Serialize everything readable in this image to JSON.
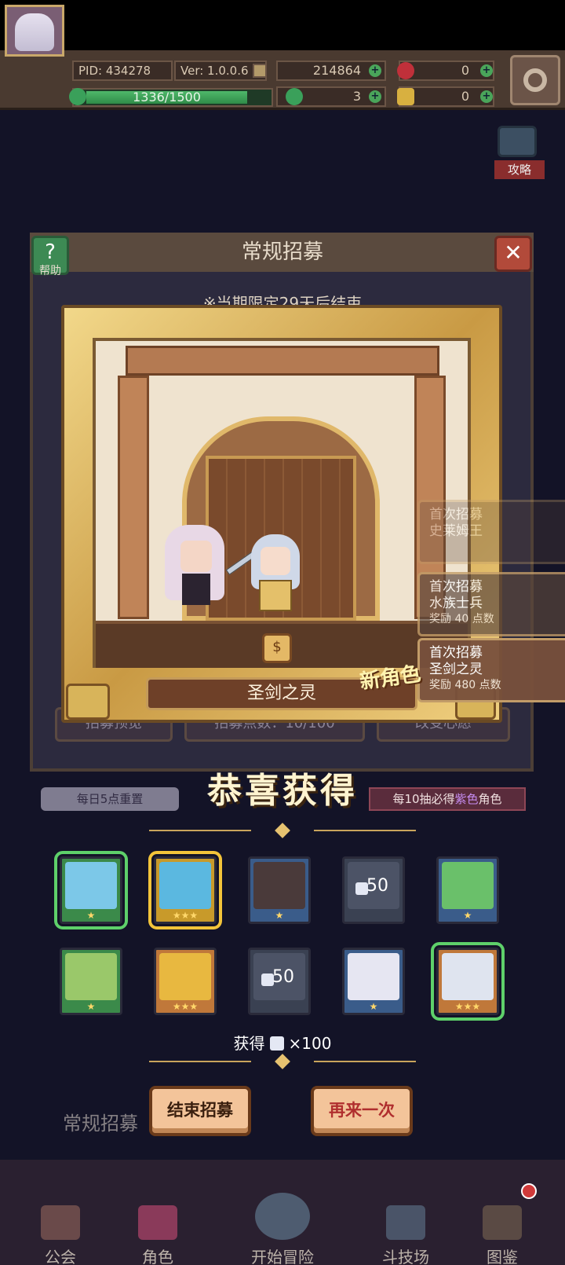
{
  "top_bar": {
    "pid": "PID: 434278",
    "version": "Ver: 1.0.0.6",
    "exp": "1336/1500",
    "gold": "214864",
    "gem": "0",
    "clover": "3",
    "key": "0"
  },
  "guide": {
    "label": "攻略"
  },
  "panel": {
    "title": "常规招募",
    "help_label": "帮助",
    "limit_text": "※当期限定29天后结束",
    "buttons": [
      "招募预览",
      "招募点数：10/100",
      "改变心愿"
    ]
  },
  "reveal": {
    "character_name": "圣剑之灵",
    "new_character_tag": "新角色"
  },
  "notifications": [
    {
      "title": "首次招募",
      "name": "史莱姆王",
      "reward": ""
    },
    {
      "title": "首次招募",
      "name": "水族士兵",
      "reward": "奖励 40 点数"
    },
    {
      "title": "首次招募",
      "name": "圣剑之灵",
      "reward": "奖励 480 点数"
    }
  ],
  "congrats": "恭喜获得",
  "daily_reset": "每日5点重置",
  "guarantee": {
    "prefix": "每10抽必得",
    "highlight": "紫色",
    "suffix": "角色"
  },
  "rewards": [
    {
      "type": "character",
      "stars": "★",
      "portrait_color": "#7cc8e8",
      "frame": "green",
      "selected": "green"
    },
    {
      "type": "character",
      "stars": "★★★",
      "portrait_color": "#5bb8e0",
      "frame": "gold",
      "selected": "gold"
    },
    {
      "type": "character",
      "stars": "★",
      "portrait_color": "#4a3a3a",
      "frame": "blue",
      "selected": ""
    },
    {
      "type": "item",
      "quantity": "50"
    },
    {
      "type": "character",
      "stars": "★",
      "portrait_color": "#6ac06a",
      "frame": "blue",
      "selected": ""
    },
    {
      "type": "character",
      "stars": "★",
      "portrait_color": "#9ac86a",
      "frame": "green",
      "selected": ""
    },
    {
      "type": "character",
      "stars": "★★★",
      "portrait_color": "#e8b840",
      "frame": "orange",
      "selected": ""
    },
    {
      "type": "item",
      "quantity": "50"
    },
    {
      "type": "character",
      "stars": "★",
      "portrait_color": "#e6e6f2",
      "frame": "blue",
      "selected": ""
    },
    {
      "type": "character",
      "stars": "★★★",
      "portrait_color": "#dfe4ef",
      "frame": "orange",
      "selected": "green"
    }
  ],
  "obtained": {
    "label": "获得",
    "amount": "×100"
  },
  "regular_label": "常规招募",
  "actions": {
    "end": "结束招募",
    "again": "再来一次"
  },
  "nav": [
    "公会",
    "角色",
    "开始冒险",
    "斗技场",
    "图鉴"
  ],
  "colors": {
    "gold_frame": "#f0d080",
    "accent_green": "#5ed06a",
    "accent_gold": "#f3c43a"
  }
}
